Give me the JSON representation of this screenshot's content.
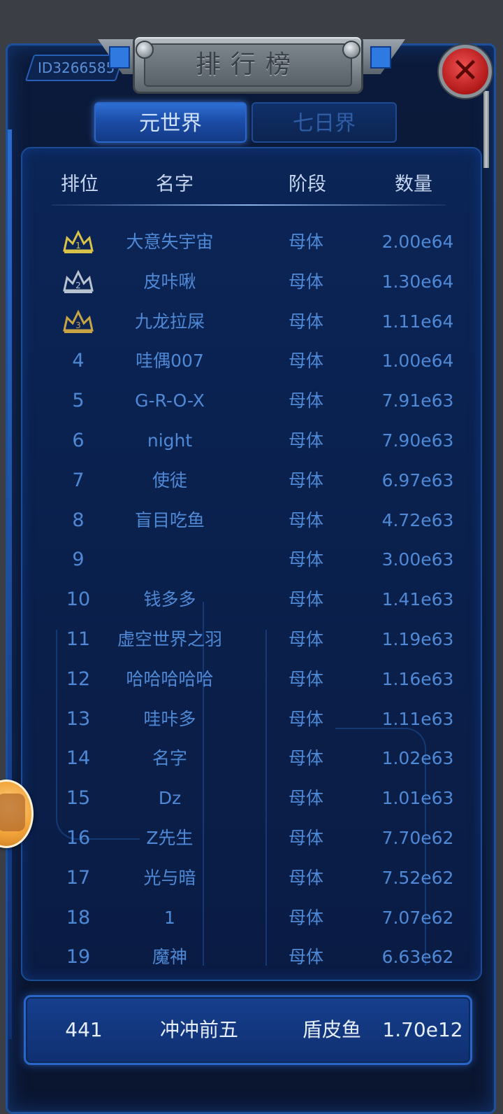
{
  "player": {
    "id": "ID3266585"
  },
  "title": "排行榜",
  "tabs": [
    {
      "label": "元世界",
      "active": true
    },
    {
      "label": "七日界",
      "active": false
    }
  ],
  "table": {
    "headers": [
      "排位",
      "名字",
      "阶段",
      "数量"
    ],
    "rows": [
      {
        "rank": "1",
        "name": "大意失宇宙",
        "stage": "母体",
        "amount": "2.00e64",
        "crown": "gold"
      },
      {
        "rank": "2",
        "name": "皮咔啾",
        "stage": "母体",
        "amount": "1.30e64",
        "crown": "silver"
      },
      {
        "rank": "3",
        "name": "九龙拉屎",
        "stage": "母体",
        "amount": "1.11e64",
        "crown": "bronze"
      },
      {
        "rank": "4",
        "name": "哇偶007",
        "stage": "母体",
        "amount": "1.00e64"
      },
      {
        "rank": "5",
        "name": "G-R-O-X",
        "stage": "母体",
        "amount": "7.91e63"
      },
      {
        "rank": "6",
        "name": "night",
        "stage": "母体",
        "amount": "7.90e63"
      },
      {
        "rank": "7",
        "name": "使徒",
        "stage": "母体",
        "amount": "6.97e63"
      },
      {
        "rank": "8",
        "name": "盲目吃鱼",
        "stage": "母体",
        "amount": "4.72e63"
      },
      {
        "rank": "9",
        "name": "",
        "stage": "母体",
        "amount": "3.00e63"
      },
      {
        "rank": "10",
        "name": "钱多多",
        "stage": "母体",
        "amount": "1.41e63"
      },
      {
        "rank": "11",
        "name": "虚空世界之羽",
        "stage": "母体",
        "amount": "1.19e63"
      },
      {
        "rank": "12",
        "name": "哈哈哈哈哈",
        "stage": "母体",
        "amount": "1.16e63"
      },
      {
        "rank": "13",
        "name": "哇咔多",
        "stage": "母体",
        "amount": "1.11e63"
      },
      {
        "rank": "14",
        "name": "名字",
        "stage": "母体",
        "amount": "1.02e63"
      },
      {
        "rank": "15",
        "name": "Dz",
        "stage": "母体",
        "amount": "1.01e63"
      },
      {
        "rank": "16",
        "name": "Z先生",
        "stage": "母体",
        "amount": "7.70e62"
      },
      {
        "rank": "17",
        "name": "光与暗",
        "stage": "母体",
        "amount": "7.52e62"
      },
      {
        "rank": "18",
        "name": "1",
        "stage": "母体",
        "amount": "7.07e62"
      },
      {
        "rank": "19",
        "name": "魔神",
        "stage": "母体",
        "amount": "6.63e62"
      }
    ]
  },
  "self": {
    "rank": "441",
    "name": "冲冲前五",
    "stage": "盾皮鱼",
    "amount": "1.70e12"
  },
  "colors": {
    "crown_gold": "#d8c24a",
    "crown_silver": "#b9c3cf",
    "crown_bronze": "#c9a445",
    "row_text": "#4f89d6"
  },
  "icons": {
    "close": "close-icon",
    "crown": "crown-icon",
    "side_widget": "floating-helper-icon"
  }
}
